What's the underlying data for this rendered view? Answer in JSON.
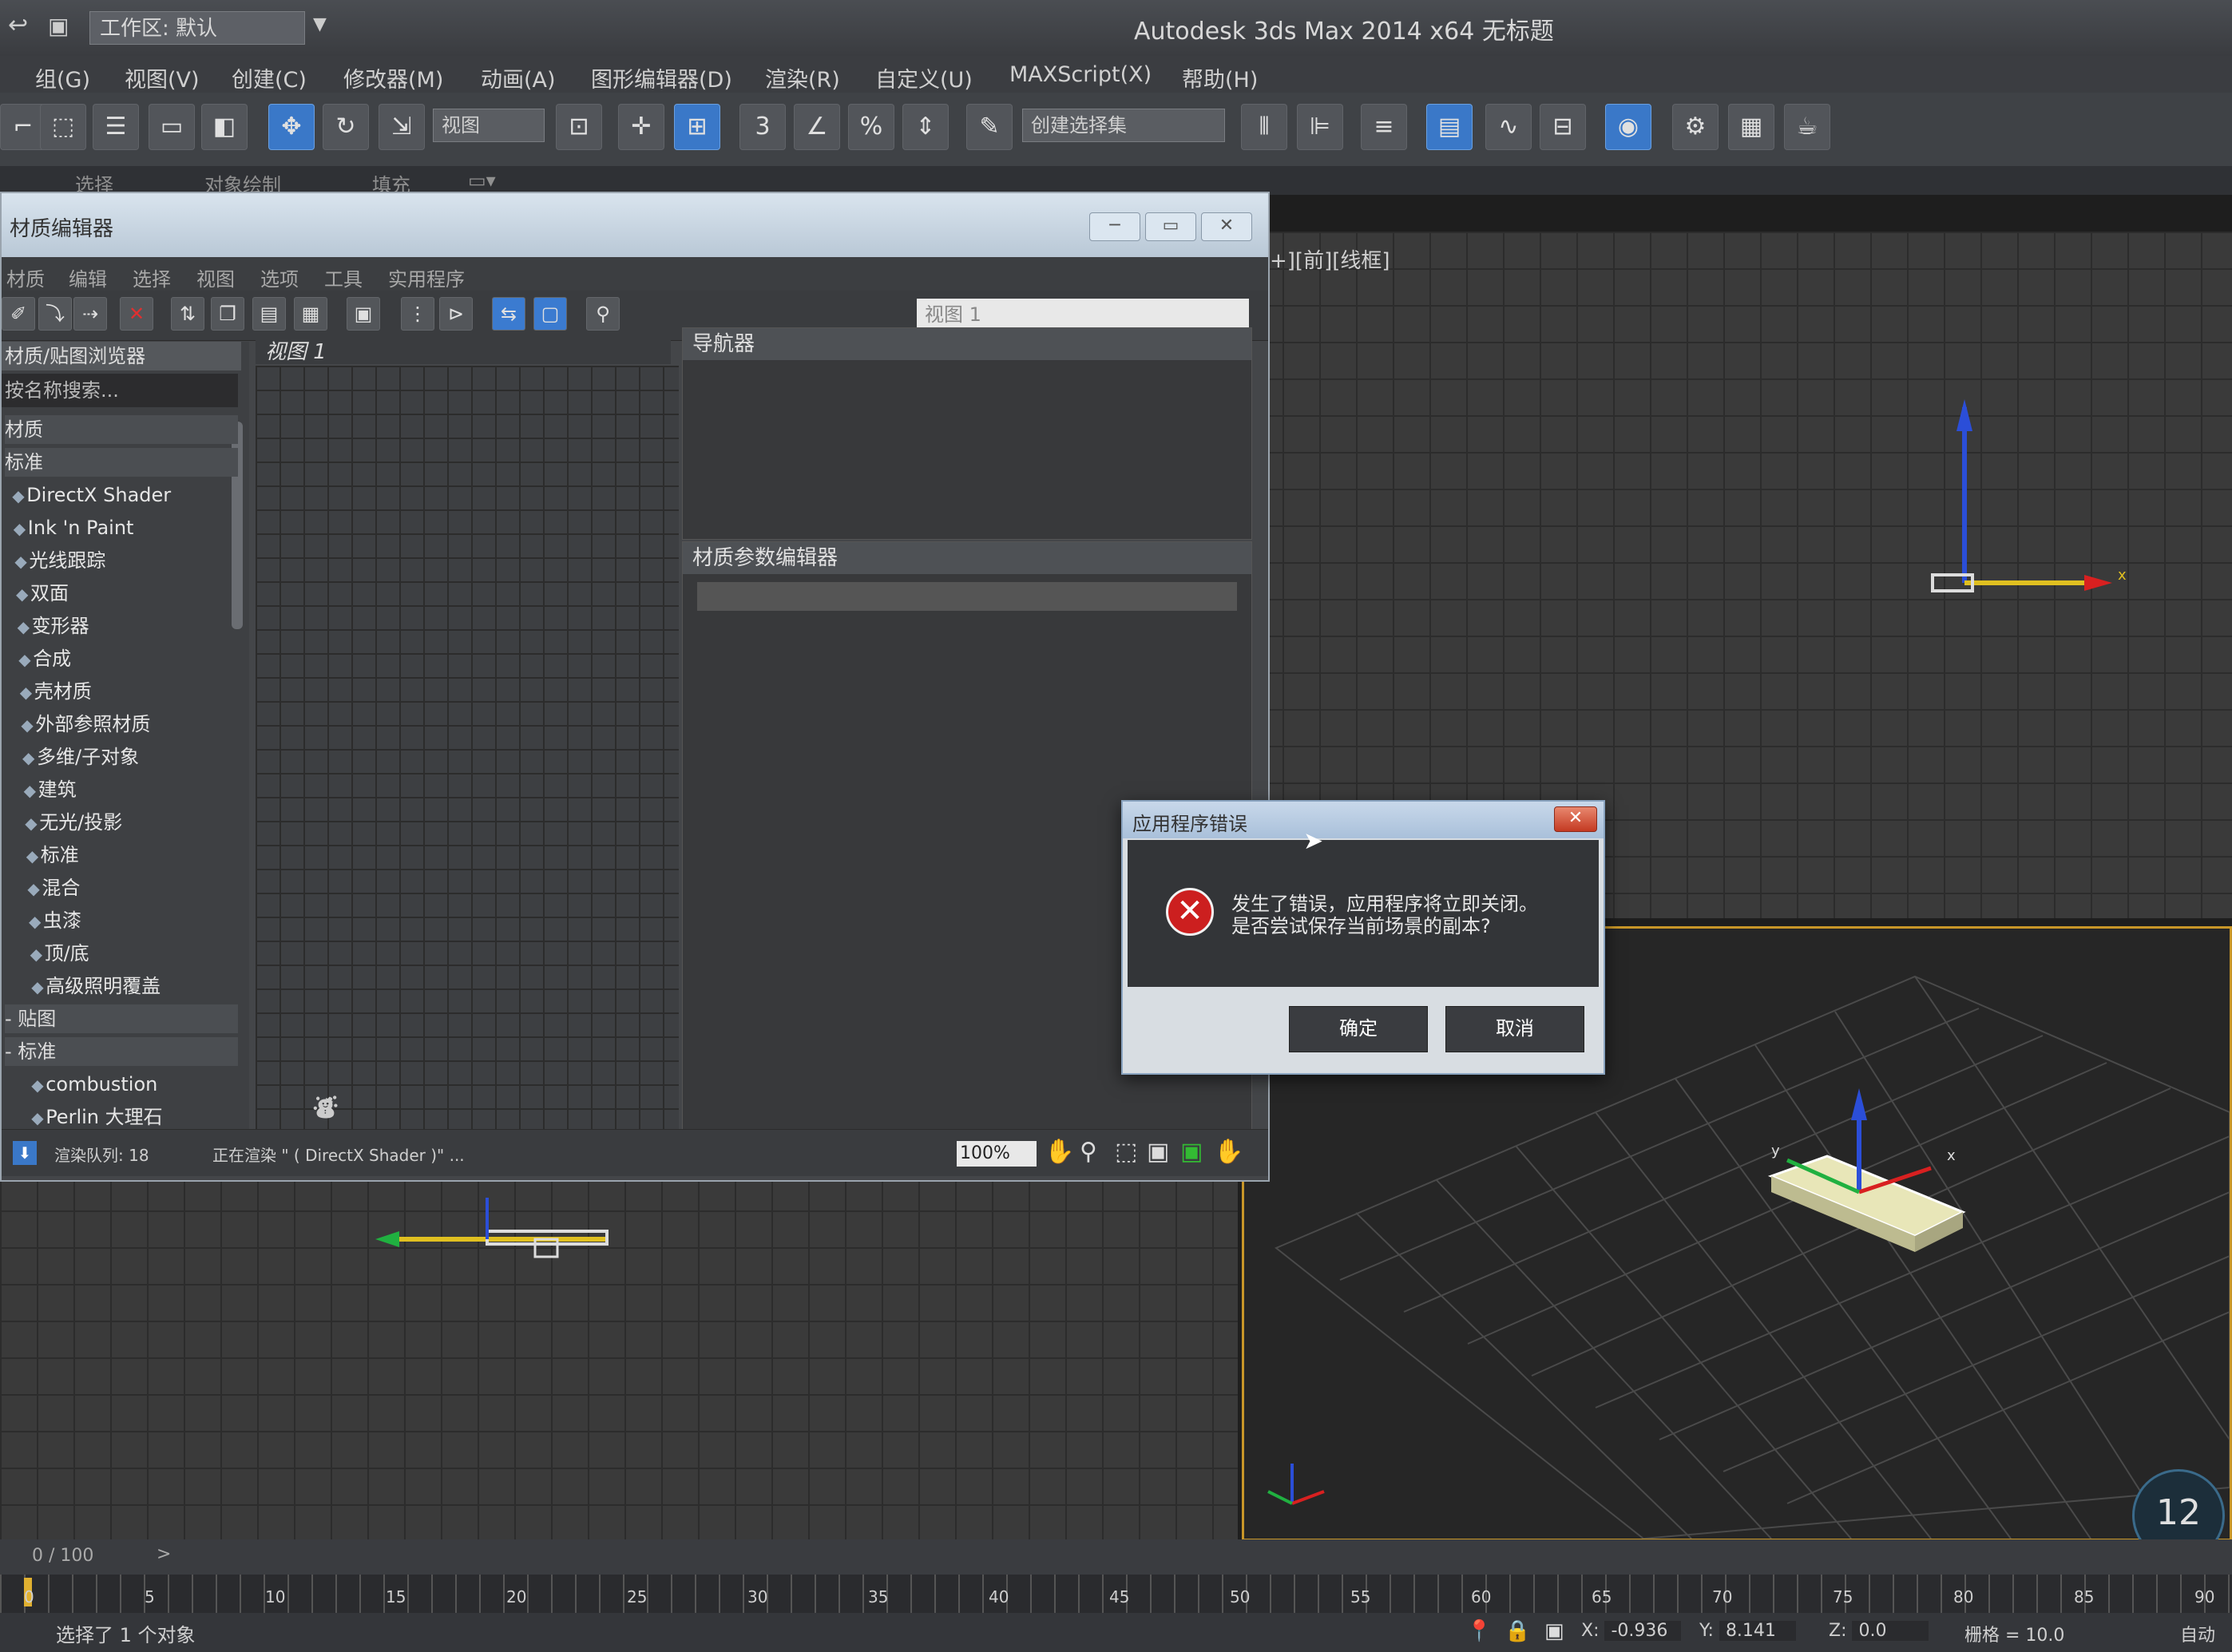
{
  "titlebar": {
    "workspace_label": "工作区: 默认",
    "app_title": "Autodesk 3ds Max  2014 x64     无标题"
  },
  "menubar": {
    "items": [
      "组(G)",
      "视图(V)",
      "创建(C)",
      "修改器(M)",
      "动画(A)",
      "图形编辑器(D)",
      "渲染(R)",
      "自定义(U)",
      "MAXScript(X)",
      "帮助(H)"
    ]
  },
  "toolbar": {
    "view_combo": "视图",
    "selection_set_combo": "创建选择集"
  },
  "ribbon": {
    "tabs": [
      "选择",
      "对象绘制",
      "填充"
    ]
  },
  "viewport_front": {
    "label": "+][前][线框]"
  },
  "material_editor": {
    "title": "材质编辑器",
    "menus": [
      "材质",
      "编辑",
      "选择",
      "视图",
      "选项",
      "工具",
      "实用程序"
    ],
    "view_select": "视图 1",
    "browser_header": "材质/贴图浏览器",
    "browser_search": "按名称搜索...",
    "browser_rows": [
      {
        "text": "材质",
        "type": "cat"
      },
      {
        "text": "标准",
        "type": "cat"
      },
      {
        "text": "DirectX Shader",
        "type": "item"
      },
      {
        "text": "Ink 'n Paint",
        "type": "item"
      },
      {
        "text": "光线跟踪",
        "type": "item"
      },
      {
        "text": "双面",
        "type": "item"
      },
      {
        "text": "变形器",
        "type": "item"
      },
      {
        "text": "合成",
        "type": "item"
      },
      {
        "text": "壳材质",
        "type": "item"
      },
      {
        "text": "外部参照材质",
        "type": "item"
      },
      {
        "text": "多维/子对象",
        "type": "item"
      },
      {
        "text": "建筑",
        "type": "item"
      },
      {
        "text": "无光/投影",
        "type": "item"
      },
      {
        "text": "标准",
        "type": "item"
      },
      {
        "text": "混合",
        "type": "item"
      },
      {
        "text": "虫漆",
        "type": "item"
      },
      {
        "text": "顶/底",
        "type": "item"
      },
      {
        "text": "高级照明覆盖",
        "type": "item"
      },
      {
        "text": "- 贴图",
        "type": "cat"
      },
      {
        "text": "- 标准",
        "type": "cat"
      },
      {
        "text": "combustion",
        "type": "item"
      },
      {
        "text": "Perlin 大理石",
        "type": "item"
      }
    ],
    "view_tab": "视图 1",
    "navigator_header": "导航器",
    "param_header": "材质参数编辑器",
    "status_queue": "渲染队列: 18",
    "status_rendering": "正在渲染 \" ( DirectX Shader )\" ...",
    "zoom": "100%"
  },
  "error_dialog": {
    "title": "应用程序错误",
    "close": "✕",
    "message_line1": "发生了错误，应用程序将立即关闭。",
    "message_line2": "是否尝试保存当前场景的副本?",
    "ok": "确定",
    "cancel": "取消"
  },
  "timeline": {
    "counter": "0 / 100",
    "ticks": [
      "0",
      "5",
      "10",
      "15",
      "20",
      "25",
      "30",
      "35",
      "40",
      "45",
      "50",
      "55",
      "60",
      "65",
      "70",
      "75",
      "80",
      "85",
      "90"
    ]
  },
  "status": {
    "selection": "选择了 1 个对象",
    "x_label": "X:",
    "x_value": "-0.936",
    "y_label": "Y:",
    "y_value": "8.141",
    "z_label": "Z:",
    "z_value": "0.0",
    "grid": "栅格 = 10.0",
    "autokey": "自动"
  },
  "fps_badge": "12",
  "colors": {
    "accent": "#3a78c8",
    "viewport_border": "#c89628",
    "error_red": "#cc1f1f"
  }
}
